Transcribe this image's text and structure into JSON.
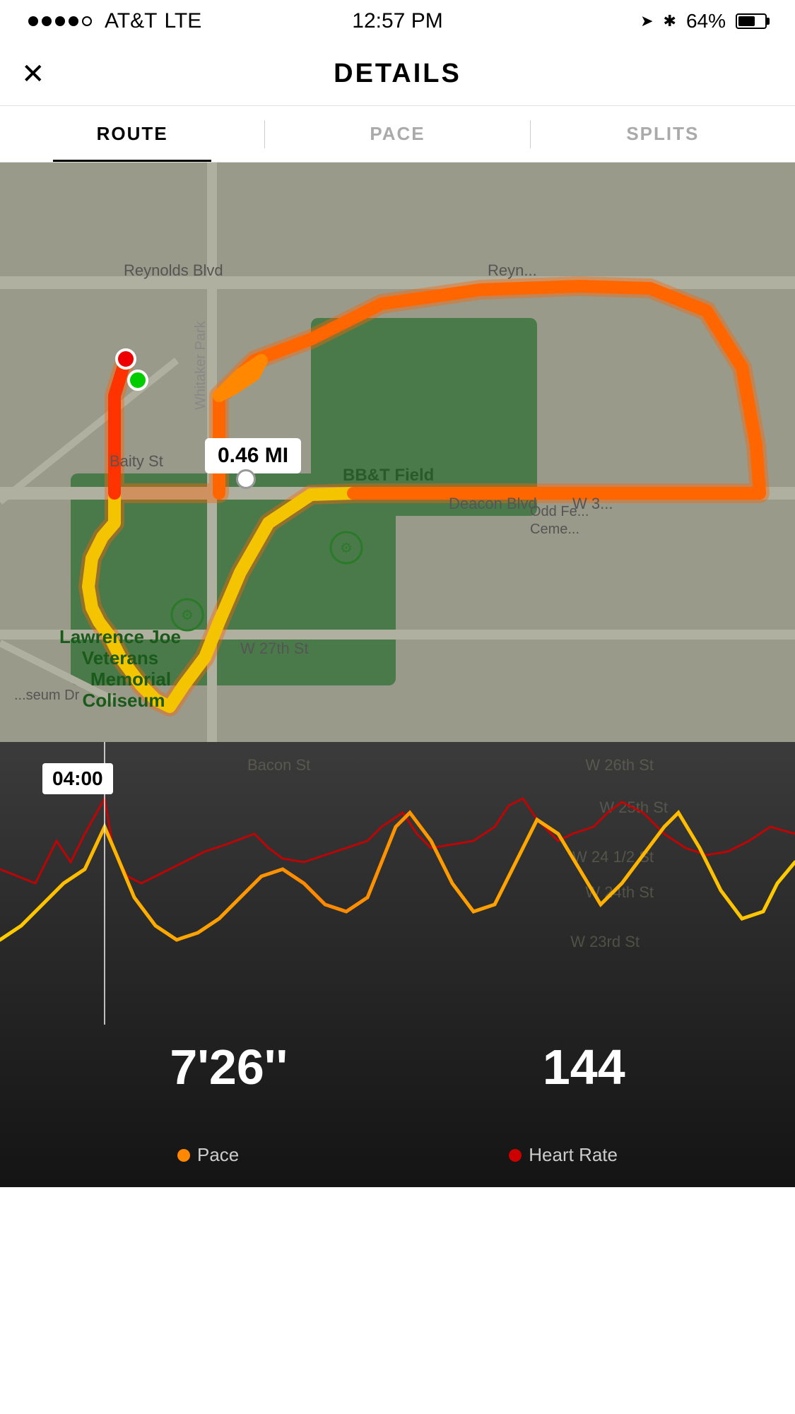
{
  "status": {
    "carrier": "AT&T",
    "network": "LTE",
    "time": "12:57 PM",
    "battery_pct": "64%",
    "battery_fill": 64
  },
  "header": {
    "title": "DETAILS",
    "close_label": "✕"
  },
  "tabs": [
    {
      "id": "route",
      "label": "ROUTE",
      "active": true
    },
    {
      "id": "pace",
      "label": "PACE",
      "active": false
    },
    {
      "id": "splits",
      "label": "SPLITS",
      "active": false
    }
  ],
  "map": {
    "distance_label": "0.46 MI"
  },
  "chart": {
    "time_tooltip": "04:00",
    "pace_value": "7'26''",
    "heart_rate_value": "144"
  },
  "legend": {
    "pace_label": "Pace",
    "heart_rate_label": "Heart Rate",
    "pace_color": "#ff8c00",
    "heart_rate_color": "#cc0000"
  }
}
